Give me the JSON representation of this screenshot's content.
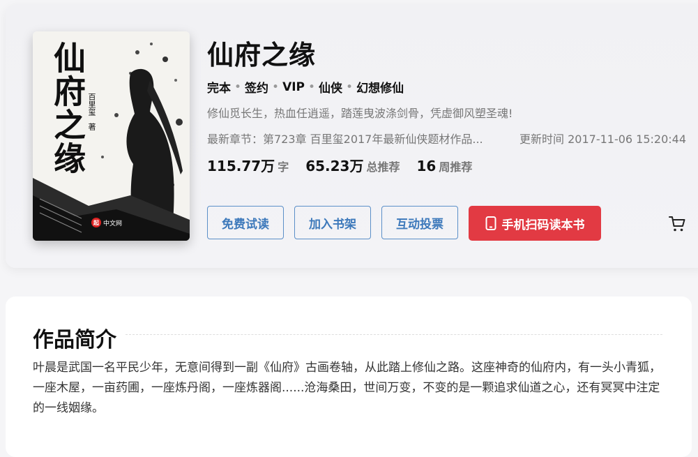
{
  "book": {
    "title": "仙府之缘",
    "cover_title": "仙府之缘",
    "cover_author": "百里玺",
    "cover_author_suffix": "著",
    "cover_publisher": "中文网",
    "cover_logo": "起",
    "tags": [
      "完本",
      "签约",
      "VIP",
      "仙侠",
      "幻想修仙"
    ],
    "tag_separator": "•",
    "description": "修仙觅长生，热血任逍遥，踏莲曳波涤剑骨，凭虚御风塑圣魂!",
    "latest_label": "最新章节：",
    "latest_chapter": "第723章 百里玺2017年最新仙侠题材作品...",
    "update_label": "更新时间",
    "update_time": "2017-11-06 15:20:44",
    "stats": [
      {
        "value": "115.77万",
        "unit": "字"
      },
      {
        "value": "65.23万",
        "unit": "总推荐"
      },
      {
        "value": "16",
        "unit": "周推荐"
      }
    ]
  },
  "actions": {
    "free_read": "免费试读",
    "add_shelf": "加入书架",
    "vote": "互动投票",
    "scan_read": "手机扫码读本书"
  },
  "icons": {
    "phone": "phone-icon",
    "cart": "cart-icon"
  },
  "colors": {
    "accent_blue": "#3d79bb",
    "accent_red": "#e23a43"
  },
  "intro": {
    "heading": "作品简介",
    "text": "叶晨是武国一名平民少年，无意间得到一副《仙府》古画卷轴，从此踏上修仙之路。这座神奇的仙府内，有一头小青狐，一座木屋，一亩药圃，一座炼丹阁，一座炼器阁......沧海桑田，世间万变，不变的是一颗追求仙道之心，还有冥冥中注定的一线姻缘。"
  }
}
